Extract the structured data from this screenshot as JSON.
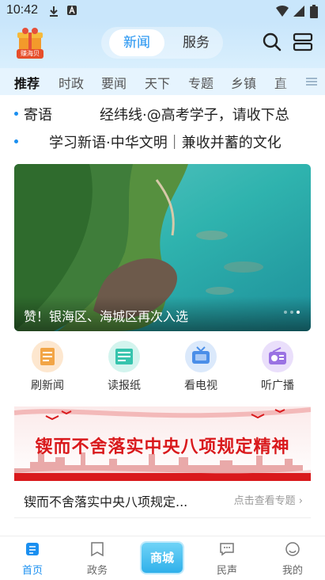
{
  "status_bar": {
    "time": "10:42"
  },
  "header": {
    "logo_text": "赚海贝",
    "segment_tabs": [
      {
        "label": "新闻",
        "active": true
      },
      {
        "label": "服务",
        "active": false
      }
    ]
  },
  "categories": [
    "推荐",
    "时政",
    "要闻",
    "天下",
    "专题",
    "乡镇",
    "直"
  ],
  "tickers": [
    {
      "source": "寄语",
      "text": "经纬线·@高考学子，请收下总"
    },
    {
      "source": "",
      "text": "学习新语·中华文明｜兼收并蓄的文化"
    }
  ],
  "banner": {
    "caption": "赞！银海区、海城区再次入选",
    "pages": 3,
    "active_page": 3
  },
  "quick_links": [
    {
      "label": "刷新闻",
      "icon": "news-refresh-icon"
    },
    {
      "label": "读报纸",
      "icon": "newspaper-icon"
    },
    {
      "label": "看电视",
      "icon": "tv-icon"
    },
    {
      "label": "听广播",
      "icon": "radio-icon"
    }
  ],
  "promo": {
    "banner_title": "锲而不舍落实中央八项规定精神",
    "topic_title": "锲而不舍落实中央八项规定...",
    "topic_link": "点击查看专题"
  },
  "tabbar": {
    "items": [
      {
        "label": "首页",
        "active": true
      },
      {
        "label": "政务",
        "active": false
      },
      {
        "label": "商城",
        "active": false
      },
      {
        "label": "民声",
        "active": false
      },
      {
        "label": "我的",
        "active": false
      }
    ]
  },
  "colors": {
    "accent": "#1a8ff0",
    "promo_red": "#d9191c",
    "header_bg": "#c9e6fb"
  }
}
